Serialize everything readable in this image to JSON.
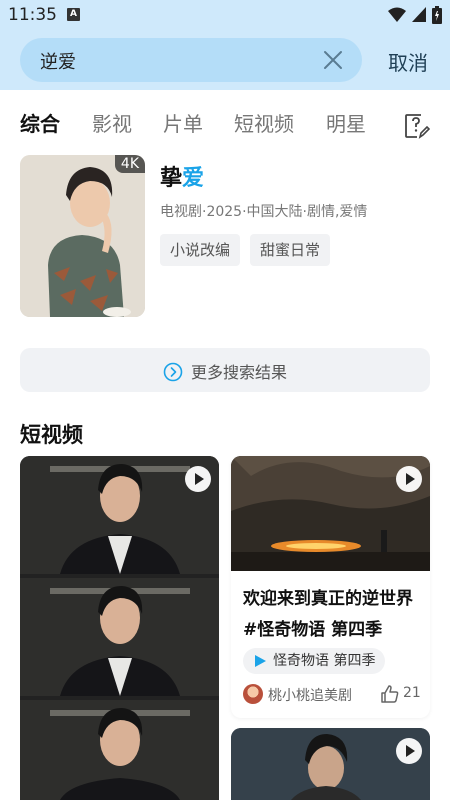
{
  "status_bar": {
    "time": "11:35",
    "notification_letter": "A"
  },
  "search": {
    "query": "逆爱",
    "cancel_label": "取消"
  },
  "tabs": [
    {
      "label": "综合",
      "active": true
    },
    {
      "label": "影视",
      "active": false
    },
    {
      "label": "片单",
      "active": false
    },
    {
      "label": "短视频",
      "active": false
    },
    {
      "label": "明星",
      "active": false
    }
  ],
  "result": {
    "badge": "4K",
    "title_prefix": "挚",
    "title_highlight": "爱",
    "meta": "电视剧·2025·中国大陆·剧情,爱情",
    "tags": [
      "小说改编",
      "甜蜜日常"
    ]
  },
  "more_results_label": "更多搜索结果",
  "short_video_section": {
    "title": "短视频",
    "card": {
      "caption_line1": "欢迎来到真正的逆世界",
      "caption_line2": "#怪奇物语 第四季",
      "series": "怪奇物语 第四季",
      "author": "桃小桃追美剧",
      "likes": "21"
    }
  },
  "colors": {
    "accent": "#1aa3e8",
    "header_bg": "#cfe9fb",
    "search_box": "#b4ddf8"
  }
}
